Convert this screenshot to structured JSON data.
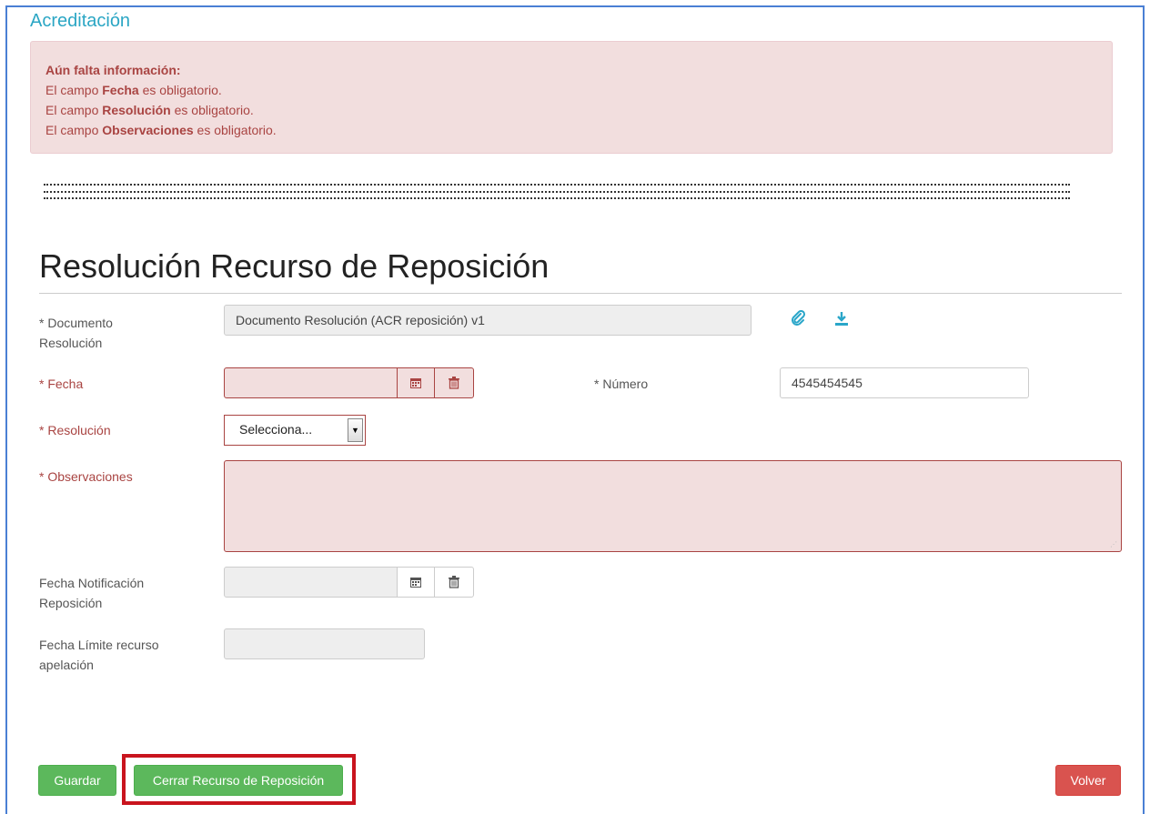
{
  "section": {
    "title": "Acreditación"
  },
  "alert": {
    "heading": "Aún falta información:",
    "lines": [
      {
        "prefix": "El campo ",
        "field": "Fecha",
        "suffix": " es obligatorio."
      },
      {
        "prefix": "El campo ",
        "field": "Resolución",
        "suffix": " es obligatorio."
      },
      {
        "prefix": "El campo ",
        "field": "Observaciones",
        "suffix": " es obligatorio."
      }
    ]
  },
  "form": {
    "title": "Resolución Recurso de Reposición",
    "documento": {
      "label_1": "* Documento",
      "label_2": "Resolución",
      "value": "Documento Resolución (ACR reposición) v1"
    },
    "fecha": {
      "label": "* Fecha",
      "value": ""
    },
    "numero": {
      "label": "* Número",
      "value": "4545454545"
    },
    "resolucion": {
      "label": "* Resolución",
      "selected": "Selecciona..."
    },
    "observaciones": {
      "label": "* Observaciones",
      "value": ""
    },
    "fecha_notificacion": {
      "label_1": "Fecha Notificación",
      "label_2": "Reposición",
      "value": ""
    },
    "fecha_limite": {
      "label_1": "Fecha Límite recurso",
      "label_2": "apelación",
      "value": ""
    }
  },
  "icons": {
    "calendar": "calendar-icon",
    "trash": "trash-icon",
    "paperclip": "paperclip-icon",
    "download": "download-icon"
  },
  "buttons": {
    "guardar": "Guardar",
    "cerrar": "Cerrar Recurso de Reposición",
    "volver": "Volver"
  },
  "colors": {
    "accent": "#2ba6c4",
    "error_bg": "#f2dede",
    "error_text": "#a94442",
    "success": "#5cb85c",
    "danger": "#d9534f",
    "highlight": "#c9141e"
  }
}
